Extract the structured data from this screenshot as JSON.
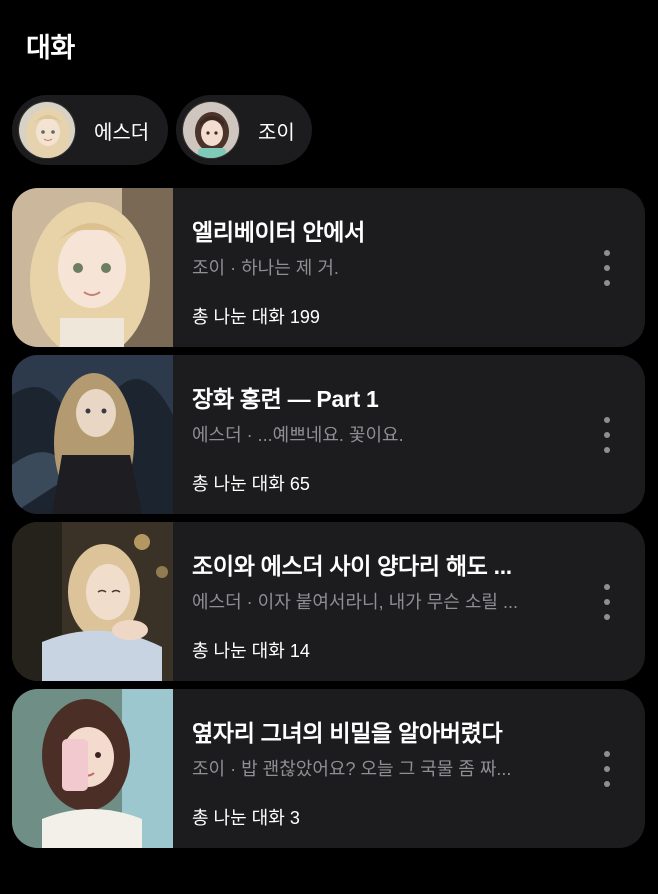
{
  "header": {
    "title": "대화"
  },
  "characters": [
    {
      "name": "에스더",
      "avatar": "esther-avatar"
    },
    {
      "name": "조이",
      "avatar": "joy-avatar"
    }
  ],
  "conversations": [
    {
      "title": "엘리베이터 안에서",
      "subtitle": "조이 · 하나는 제 거.",
      "count_label": "총 나눈 대화",
      "count": "199",
      "thumbnail": "blonde-wavy-hair-girl-portrait",
      "more_icon": "more-vertical-icon"
    },
    {
      "title": "장화 홍련 — Part 1",
      "subtitle": "에스더 · ...예쁘네요. 꽃이요.",
      "count_label": "총 나눈 대화",
      "count": "65",
      "thumbnail": "long-hair-girl-night-forest",
      "more_icon": "more-vertical-icon"
    },
    {
      "title": "조이와 에스더 사이 양다리 해도 ...",
      "subtitle": "에스더 · 이자 붙여서라니, 내가 무슨 소릴 ...",
      "count_label": "총 나눈 대화",
      "count": "14",
      "thumbnail": "blonde-girl-resting-chin",
      "more_icon": "more-vertical-icon"
    },
    {
      "title": "옆자리 그녀의 비밀을 알아버렸다",
      "subtitle": "조이 · 밥 괜찮았어요? 오늘 그 국물 좀 짜...",
      "count_label": "총 나눈 대화",
      "count": "3",
      "thumbnail": "brunette-girl-phone-selfie",
      "more_icon": "more-vertical-icon"
    }
  ],
  "colors": {
    "background": "#000000",
    "card": "#1c1c1e",
    "text_primary": "#ffffff",
    "text_secondary": "#8e8e93"
  }
}
